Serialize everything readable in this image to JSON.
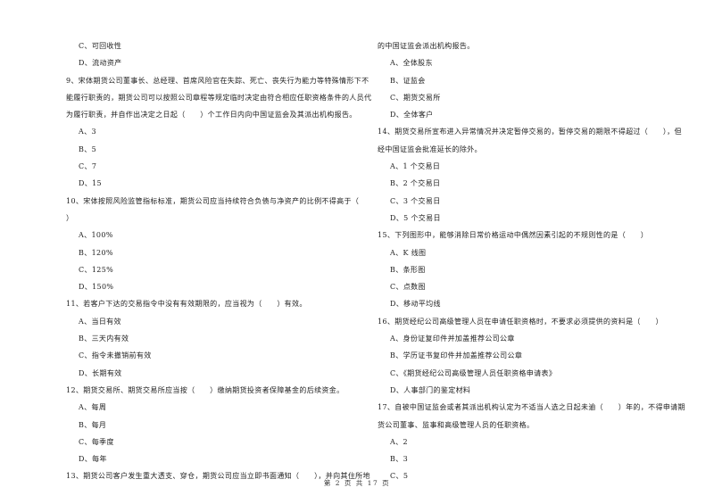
{
  "page": {
    "footer": "第 2 页 共 17 页"
  },
  "left_column": [
    {
      "type": "opt",
      "text": "C、可回收性"
    },
    {
      "type": "opt",
      "text": "D、流动资产"
    },
    {
      "type": "q",
      "text": "9、宋体期货公司董事长、总经理、首席风险官在失踪、死亡、丧失行为能力等特殊情形下不"
    },
    {
      "type": "q",
      "text": "能履行职责的，期货公司可以按照公司章程等规定临时决定由符合相应任职资格条件的人员代"
    },
    {
      "type": "q",
      "text": "为履行职责，并自作出决定之日起（　　）个工作日内向中国证监会及其派出机构报告。"
    },
    {
      "type": "opt",
      "text": "A、3"
    },
    {
      "type": "opt",
      "text": "B、5"
    },
    {
      "type": "opt",
      "text": "C、7"
    },
    {
      "type": "opt",
      "text": "D、15"
    },
    {
      "type": "q",
      "text": "10、宋体按照风险监管指标标准，期货公司应当持续符合负债与净资产的比例不得高于（"
    },
    {
      "type": "q",
      "text": "）"
    },
    {
      "type": "opt",
      "text": "A、100%"
    },
    {
      "type": "opt",
      "text": "B、120%"
    },
    {
      "type": "opt",
      "text": "C、125%"
    },
    {
      "type": "opt",
      "text": "D、150%"
    },
    {
      "type": "q",
      "text": "11、若客户下达的交易指令中没有有效期限的，应当视为（　　）有效。"
    },
    {
      "type": "opt",
      "text": "A、当日有效"
    },
    {
      "type": "opt",
      "text": "B、三天内有效"
    },
    {
      "type": "opt",
      "text": "C、指令未撤销前有效"
    },
    {
      "type": "opt",
      "text": "D、长期有效"
    },
    {
      "type": "q",
      "text": "12、期货交易所、期货交易所应当按（　　）缴纳期货投资者保障基金的后续资金。"
    },
    {
      "type": "opt",
      "text": "A、每周"
    },
    {
      "type": "opt",
      "text": "B、每月"
    },
    {
      "type": "opt",
      "text": "C、每季度"
    },
    {
      "type": "opt",
      "text": "D、每年"
    },
    {
      "type": "q",
      "text": "13、期货公司客户发生重大透支、穿仓，期货公司应当立即书面通知（　　），并向其住所地"
    }
  ],
  "right_column": [
    {
      "type": "q",
      "text": "的中国证监会派出机构报告。"
    },
    {
      "type": "opt",
      "text": "A、全体股东"
    },
    {
      "type": "opt",
      "text": "B、证监会"
    },
    {
      "type": "opt",
      "text": "C、期货交易所"
    },
    {
      "type": "opt",
      "text": "D、全体客户"
    },
    {
      "type": "q",
      "text": "14、期货交易所宣布进入异常情况并决定暂停交易的，暂停交易的期限不得超过（　　），但"
    },
    {
      "type": "q",
      "text": "经中国证监会批准延长的除外。"
    },
    {
      "type": "opt",
      "text": "A、1 个交易日"
    },
    {
      "type": "opt",
      "text": "B、2 个交易日"
    },
    {
      "type": "opt",
      "text": "C、3 个交易日"
    },
    {
      "type": "opt",
      "text": "D、5 个交易日"
    },
    {
      "type": "q",
      "text": "15、下列图形中，能够消除日常价格运动中偶然因素引起的不规则性的是（　　）"
    },
    {
      "type": "opt",
      "text": "A、K 线图"
    },
    {
      "type": "opt",
      "text": "B、条形图"
    },
    {
      "type": "opt",
      "text": "C、点数图"
    },
    {
      "type": "opt",
      "text": "D、移动平均线"
    },
    {
      "type": "q",
      "text": "16、期货经纪公司高级管理人员在申请任职资格时，不要求必须提供的资料是（　　）"
    },
    {
      "type": "opt",
      "text": "A、身份证复印件并加盖推荐公司公章"
    },
    {
      "type": "opt",
      "text": "B、学历证书复印件并加盖推荐公司公章"
    },
    {
      "type": "opt",
      "text": "C、《期货经纪公司高级管理人员任职资格申请表》"
    },
    {
      "type": "opt",
      "text": "D、人事部门的鉴定材料"
    },
    {
      "type": "q",
      "text": "17、自被中国证监会或者其派出机构认定为不适当人选之日起未逾（　　）年的，不得申请期"
    },
    {
      "type": "q",
      "text": "货公司董事、监事和高级管理人员的任职资格。"
    },
    {
      "type": "opt",
      "text": "A、2"
    },
    {
      "type": "opt",
      "text": "B、3"
    },
    {
      "type": "opt",
      "text": "C、5"
    }
  ]
}
